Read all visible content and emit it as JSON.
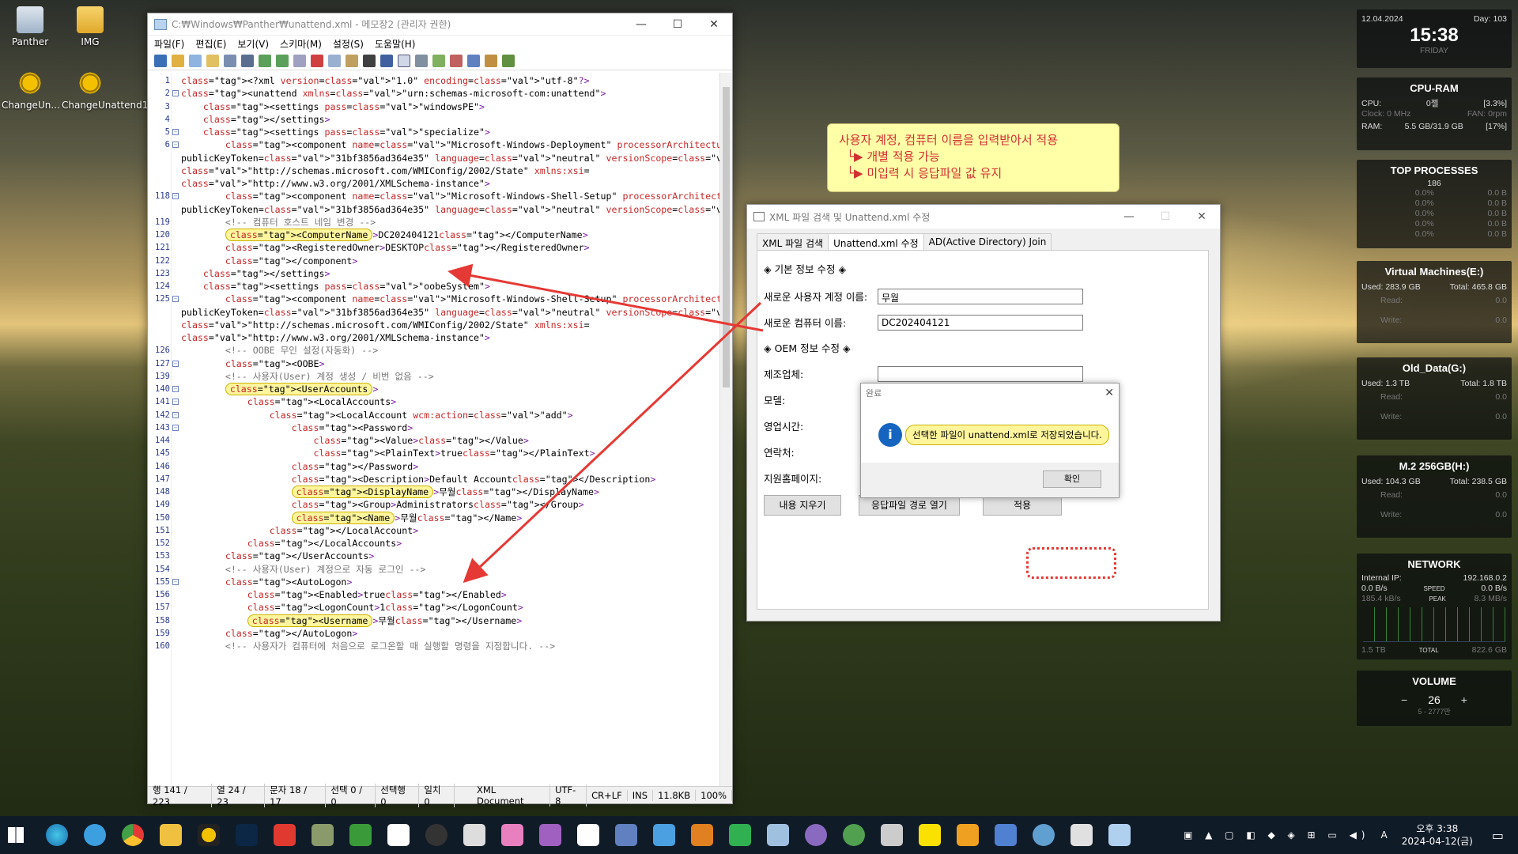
{
  "desktop_icons": [
    {
      "label": "Panther"
    },
    {
      "label": "IMG"
    },
    {
      "label": "ChangeUn..."
    },
    {
      "label": "ChangeUnattend1"
    }
  ],
  "notepad": {
    "title": "C:₩Windows₩Panther₩unattend.xml - 메모장2 (관리자 권한)",
    "menu": [
      "파일(F)",
      "편집(E)",
      "보기(V)",
      "스키마(M)",
      "설정(S)",
      "도움말(H)"
    ],
    "status": [
      "행 141 / 223",
      "열 24 / 23",
      "문자 18 / 17",
      "선택 0 / 0",
      "선택행 0",
      "일치 0",
      "XML Document",
      "UTF-8",
      "CR+LF",
      "INS",
      "11.8KB",
      "100%"
    ],
    "lines": [
      {
        "n": "1",
        "code": "<?xml version=\"1.0\" encoding=\"utf-8\"?>"
      },
      {
        "n": "2",
        "code": "<unattend xmlns=\"urn:schemas-microsoft-com:unattend\">"
      },
      {
        "n": "3",
        "code": "    <settings pass=\"windowsPE\">"
      },
      {
        "n": "4",
        "code": "    </settings>"
      },
      {
        "n": "5",
        "code": "    <settings pass=\"specialize\">"
      },
      {
        "n": "6",
        "code": "        <component name=\"Microsoft-Windows-Deployment\" processorArchitecture=\"amd64\""
      },
      {
        "n": "",
        "code": "publicKeyToken=\"31bf3856ad364e35\" language=\"neutral\" versionScope=\"nonSxS\" xmlns:wcm="
      },
      {
        "n": "",
        "code": "\"http://schemas.microsoft.com/WMIConfig/2002/State\" xmlns:xsi="
      },
      {
        "n": "",
        "code": "\"http://www.w3.org/2001/XMLSchema-instance\">"
      },
      {
        "n": "118",
        "code": "        <component name=\"Microsoft-Windows-Shell-Setup\" processorArchitecture=\"amd64\""
      },
      {
        "n": "",
        "code": "publicKeyToken=\"31bf3856ad364e35\" language=\"neutral\" versionScope=\"nonSxS\">"
      },
      {
        "n": "119",
        "code": "        <!-- 컴퓨터 호스트 네임 변경 -->"
      },
      {
        "n": "120",
        "code": "        <ComputerName>DC202404121</ComputerName>",
        "hl": true
      },
      {
        "n": "121",
        "code": "        <RegisteredOwner>DESKTOP</RegisteredOwner>"
      },
      {
        "n": "122",
        "code": "        </component>"
      },
      {
        "n": "123",
        "code": "    </settings>"
      },
      {
        "n": "124",
        "code": "    <settings pass=\"oobeSystem\">"
      },
      {
        "n": "125",
        "code": "        <component name=\"Microsoft-Windows-Shell-Setup\" processorArchitecture=\"amd64\""
      },
      {
        "n": "",
        "code": "publicKeyToken=\"31bf3856ad364e35\" language=\"neutral\" versionScope=\"nonSxS\" xmlns:wcm="
      },
      {
        "n": "",
        "code": "\"http://schemas.microsoft.com/WMIConfig/2002/State\" xmlns:xsi="
      },
      {
        "n": "",
        "code": "\"http://www.w3.org/2001/XMLSchema-instance\">"
      },
      {
        "n": "126",
        "code": "        <!-- OOBE 무인 설정(자동화) -->"
      },
      {
        "n": "127",
        "code": "        <OOBE>"
      },
      {
        "n": "139",
        "code": "        <!-- 사용자(User) 계정 생성 / 비번 없음 -->"
      },
      {
        "n": "140",
        "code": "        <UserAccounts>",
        "hl": true
      },
      {
        "n": "141",
        "code": "            <LocalAccounts>"
      },
      {
        "n": "142",
        "code": "                <LocalAccount wcm:action=\"add\">"
      },
      {
        "n": "143",
        "code": "                    <Password>"
      },
      {
        "n": "144",
        "code": "                        <Value></Value>"
      },
      {
        "n": "145",
        "code": "                        <PlainText>true</PlainText>"
      },
      {
        "n": "146",
        "code": "                    </Password>"
      },
      {
        "n": "147",
        "code": "                    <Description>Default Account</Description>"
      },
      {
        "n": "148",
        "code": "                    <DisplayName>무월</DisplayName>",
        "hl": true
      },
      {
        "n": "149",
        "code": "                    <Group>Administrators</Group>"
      },
      {
        "n": "150",
        "code": "                    <Name>무월</Name>",
        "hl": true
      },
      {
        "n": "151",
        "code": "                </LocalAccount>"
      },
      {
        "n": "152",
        "code": "            </LocalAccounts>"
      },
      {
        "n": "153",
        "code": "        </UserAccounts>"
      },
      {
        "n": "154",
        "code": "        <!-- 사용자(User) 계정으로 자동 로그인 -->"
      },
      {
        "n": "155",
        "code": "        <AutoLogon>"
      },
      {
        "n": "156",
        "code": "            <Enabled>true</Enabled>"
      },
      {
        "n": "157",
        "code": "            <LogonCount>1</LogonCount>"
      },
      {
        "n": "158",
        "code": "            <Username>무월</Username>",
        "hl": true
      },
      {
        "n": "159",
        "code": "        </AutoLogon>"
      },
      {
        "n": "160",
        "code": "        <!-- 사용자가 컴퓨터에 처음으로 로그온할 때 실행할 명령을 지정합니다. -->"
      }
    ]
  },
  "note": {
    "line1": "사용자 계정, 컴퓨터 이름을 입력받아서 적용",
    "line2": "└▶ 개별 적용 가능",
    "line3": "└▶ 미입력 시 응답파일 값 유지"
  },
  "dialog": {
    "title": "XML 파일 검색 및 Unattend.xml 수정",
    "tabs": [
      "XML 파일 검색",
      "Unattend.xml 수정",
      "AD(Active Directory) Join"
    ],
    "section_basic": "◈ 기본 정보 수정 ◈",
    "user_label": "새로운 사용자 계정 이름:",
    "user_value": "무월",
    "computer_label": "새로운 컴퓨터 이름:",
    "computer_value": "DC202404121",
    "section_oem": "◈ OEM 정보 수정 ◈",
    "maker_label": "제조업체:",
    "model_label": "모델:",
    "hours_label": "영업시간:",
    "phone_label": "연락처:",
    "support_label": "지원홈페이지:",
    "btn_clear": "내용 지우기",
    "btn_open": "응답파일 경로 열기",
    "btn_apply": "적용"
  },
  "msgbox": {
    "title": "완료",
    "text": "선택한 파일이 unattend.xml로 저장되었습니다.",
    "ok": "확인"
  },
  "widgets": {
    "date": "12.04.2024",
    "day": "Day: 103",
    "time": "15:38",
    "weekday": "FRIDAY",
    "cpu": {
      "title": "CPU-RAM",
      "cpu_label": "CPU:",
      "cpu_name": "0젤",
      "cpu_pct": "[3.3%]",
      "clock": "Clock: 0 MHz",
      "fan": "FAN: 0rpm",
      "ram_label": "RAM:",
      "ram": "5.5 GB/31.9 GB",
      "ram_pct": "[17%]"
    },
    "top": {
      "title": "TOP PROCESSES",
      "count": "186",
      "rows": [
        "0.0%",
        "0.0%",
        "0.0%",
        "0.0%",
        "0.0%"
      ],
      "vals": [
        "0.0 B",
        "0.0 B",
        "0.0 B",
        "0.0 B",
        "0.0 B"
      ]
    },
    "disks": [
      {
        "title": "Virtual Machines(E:)",
        "used": "Used: 283.9 GB",
        "total": "Total: 465.8 GB"
      },
      {
        "title": "Old_Data(G:)",
        "used": "Used: 1.3 TB",
        "total": "Total: 1.8 TB"
      },
      {
        "title": "M.2 256GB(H:)",
        "used": "Used: 104.3 GB",
        "total": "Total: 238.5 GB"
      }
    ],
    "disk_read": "Read:",
    "disk_write": "Write:",
    "disk_zero": "0.0",
    "net": {
      "title": "NETWORK",
      "ip_label": "Internal IP:",
      "ip": "192.168.0.2",
      "down": "0.0 B/s",
      "speed": "SPEED",
      "up": "0.0 B/s",
      "peak_l": "185.4 kB/s",
      "peak": "PEAK",
      "peak_r": "8.3 MB/s",
      "tot_l": "1.5 TB",
      "total": "TOTAL",
      "tot_r": "822.6 GB"
    },
    "vol": {
      "title": "VOLUME",
      "value": "26",
      "minus": "−",
      "plus": "+",
      "track": "5 - 2777만"
    }
  },
  "taskbar": {
    "time": "오후 3:38",
    "date": "2024-04-12(금)",
    "ime": "A"
  }
}
